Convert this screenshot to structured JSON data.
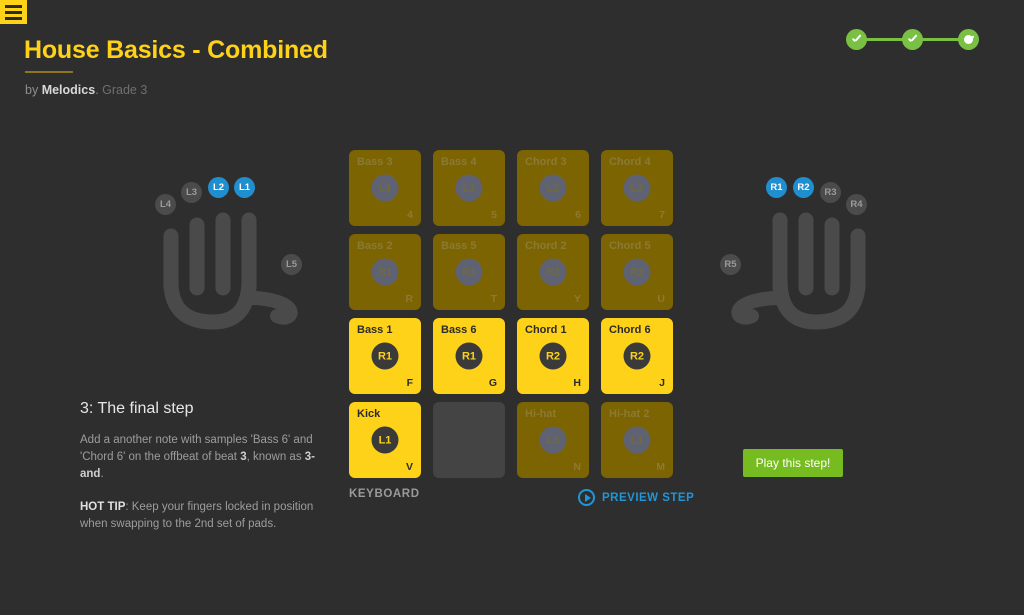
{
  "menu": {
    "icon": "hamburger-icon",
    "label": "Menu"
  },
  "header": {
    "title": "House Basics - Combined",
    "by_prefix": "by ",
    "brand": "Melodics",
    "brand_suffix": ".",
    "grade": " Grade 3"
  },
  "progress": {
    "steps": [
      {
        "state": "complete",
        "icon": "check-icon"
      },
      {
        "state": "complete",
        "icon": "check-icon"
      },
      {
        "state": "current",
        "icon": "dot-icon"
      }
    ],
    "color": "#7ac143"
  },
  "left_hand": {
    "label": "left-hand-diagram",
    "fingers": [
      {
        "id": "L4",
        "active": false
      },
      {
        "id": "L3",
        "active": false
      },
      {
        "id": "L2",
        "active": true
      },
      {
        "id": "L1",
        "active": true
      },
      {
        "id": "L5",
        "active": false
      }
    ]
  },
  "right_hand": {
    "label": "right-hand-diagram",
    "fingers": [
      {
        "id": "R1",
        "active": true
      },
      {
        "id": "R2",
        "active": true
      },
      {
        "id": "R3",
        "active": false
      },
      {
        "id": "R4",
        "active": false
      },
      {
        "id": "R5",
        "active": false
      }
    ]
  },
  "pads": [
    {
      "name": "Bass 3",
      "badge": "L1",
      "key": "4",
      "state": "dim"
    },
    {
      "name": "Bass 4",
      "badge": "L1",
      "key": "5",
      "state": "dim"
    },
    {
      "name": "Chord 3",
      "badge": "L2",
      "key": "6",
      "state": "dim"
    },
    {
      "name": "Chord 4",
      "badge": "L2",
      "key": "7",
      "state": "dim"
    },
    {
      "name": "Bass 2",
      "badge": "R1",
      "key": "R",
      "state": "dim"
    },
    {
      "name": "Bass 5",
      "badge": "R1",
      "key": "T",
      "state": "dim"
    },
    {
      "name": "Chord 2",
      "badge": "R2",
      "key": "Y",
      "state": "dim"
    },
    {
      "name": "Chord 5",
      "badge": "R2",
      "key": "U",
      "state": "dim"
    },
    {
      "name": "Bass 1",
      "badge": "R1",
      "key": "F",
      "state": "bright"
    },
    {
      "name": "Bass 6",
      "badge": "R1",
      "key": "G",
      "state": "bright"
    },
    {
      "name": "Chord 1",
      "badge": "R2",
      "key": "H",
      "state": "bright"
    },
    {
      "name": "Chord 6",
      "badge": "R2",
      "key": "J",
      "state": "bright"
    },
    {
      "name": "Kick",
      "badge": "L1",
      "key": "V",
      "state": "bright"
    },
    {
      "name": "",
      "badge": "",
      "key": "",
      "state": "empty"
    },
    {
      "name": "Hi-hat",
      "badge": "L3",
      "key": "N",
      "state": "dim"
    },
    {
      "name": "Hi-hat 2",
      "badge": "L1",
      "key": "M",
      "state": "dim"
    }
  ],
  "pad_footer": {
    "keyboard_label": "KEYBOARD",
    "preview_label": "PREVIEW STEP",
    "preview_icon": "play-circle-icon"
  },
  "play_button": {
    "label": "Play this step!",
    "color": "#76bc21"
  },
  "instructions": {
    "heading": "3: The final step",
    "body_1": "Add a another note with samples 'Bass 6' and 'Chord 6' on the offbeat of beat ",
    "body_beat": "3",
    "body_2": ", known as ",
    "body_3and": "3-and",
    "body_4": ".",
    "tip_label": "HOT TIP",
    "tip_text": ": Keep your fingers locked in position when swapping to the 2nd set of pads."
  },
  "colors": {
    "background": "#2e2e2e",
    "accent_yellow": "#ffd21a",
    "pad_dim": "#7c6403",
    "active_blue": "#1f8fd0",
    "green": "#7ac143"
  }
}
